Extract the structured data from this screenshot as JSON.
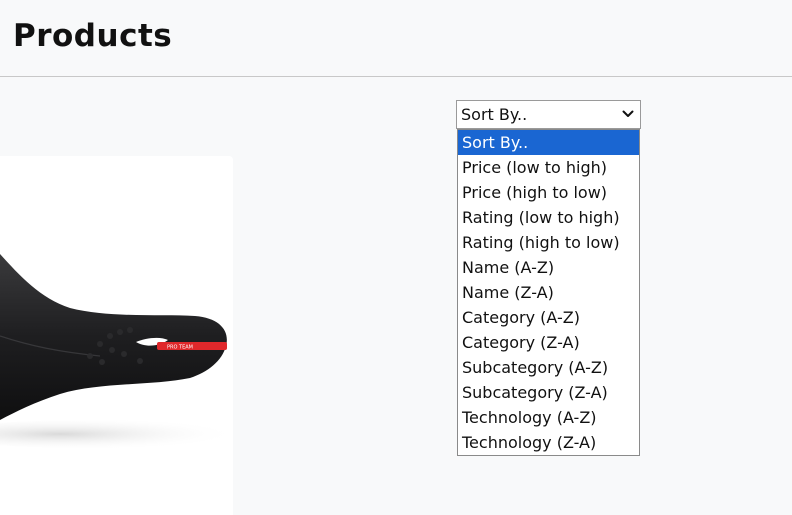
{
  "header": {
    "title": "Products"
  },
  "sort": {
    "selected": "Sort By..",
    "options": [
      "Sort By..",
      "Price (low to high)",
      "Price (high to low)",
      "Rating (low to high)",
      "Rating (high to low)",
      "Name (A-Z)",
      "Name (Z-A)",
      "Category (A-Z)",
      "Category (Z-A)",
      "Subcategory (A-Z)",
      "Subcategory (Z-A)",
      "Technology (A-Z)",
      "Technology (Z-A)"
    ],
    "highlight_color": "#1a66d2"
  },
  "product": {
    "image": "bike-saddle",
    "saddle_label": "PRO TEAM",
    "accent_color": "#e0282b"
  }
}
